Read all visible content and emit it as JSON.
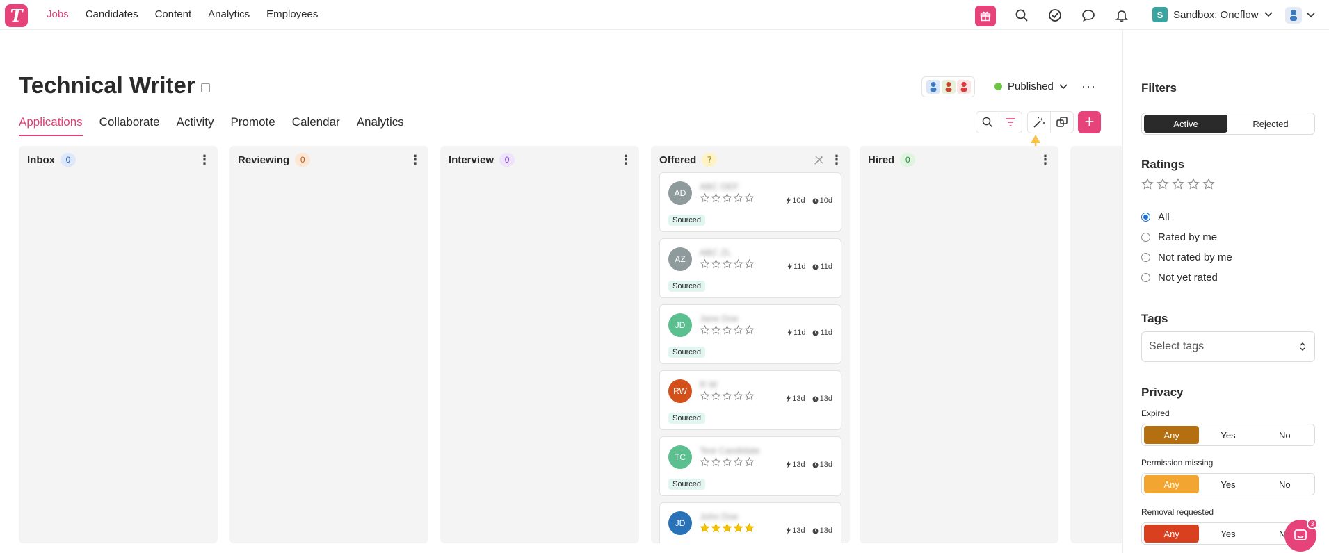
{
  "nav": {
    "logo": "T",
    "links": [
      {
        "label": "Jobs",
        "active": true
      },
      {
        "label": "Candidates",
        "active": false
      },
      {
        "label": "Content",
        "active": false
      },
      {
        "label": "Analytics",
        "active": false
      },
      {
        "label": "Employees",
        "active": false
      }
    ],
    "icons": [
      "gift-icon",
      "search-icon",
      "check-circle-icon",
      "chat-icon",
      "bell-icon"
    ],
    "workspace_badge": "S",
    "workspace_name": "Sandbox: Oneflow"
  },
  "job": {
    "title": "Technical Writer",
    "status": "Published",
    "status_color": "#6cc644"
  },
  "tabs": [
    {
      "label": "Applications",
      "active": true
    },
    {
      "label": "Collaborate",
      "active": false
    },
    {
      "label": "Activity",
      "active": false
    },
    {
      "label": "Promote",
      "active": false
    },
    {
      "label": "Calendar",
      "active": false
    },
    {
      "label": "Analytics",
      "active": false
    }
  ],
  "toolbar": {
    "add_label": "+"
  },
  "stages": [
    {
      "name": "Inbox",
      "count": "0",
      "badge_bg": "#dde8fb",
      "badge_fg": "#2a5fc4"
    },
    {
      "name": "Reviewing",
      "count": "0",
      "badge_bg": "#fde6d3",
      "badge_fg": "#b35a16"
    },
    {
      "name": "Interview",
      "count": "0",
      "badge_bg": "#efe3fb",
      "badge_fg": "#7a3fc4"
    },
    {
      "name": "Offered",
      "count": "7",
      "badge_bg": "#fdf3c4",
      "badge_fg": "#8a6a00"
    },
    {
      "name": "Hired",
      "count": "0",
      "badge_bg": "#dff5e0",
      "badge_fg": "#2a8a3a"
    }
  ],
  "candidates": [
    {
      "initials": "AD",
      "name": "ABC DEF",
      "color": "#8e9a9b",
      "rating": 0,
      "activity": "10d",
      "age": "10d",
      "tag": "Sourced"
    },
    {
      "initials": "AZ",
      "name": "ABC ZL",
      "color": "#8e9a9b",
      "rating": 0,
      "activity": "11d",
      "age": "11d",
      "tag": "Sourced"
    },
    {
      "initials": "JD",
      "name": "Jane Doe",
      "color": "#5cbf8f",
      "rating": 0,
      "activity": "11d",
      "age": "11d",
      "tag": "Sourced"
    },
    {
      "initials": "RW",
      "name": "R W",
      "color": "#d4501a",
      "rating": 0,
      "activity": "13d",
      "age": "13d",
      "tag": "Sourced"
    },
    {
      "initials": "TC",
      "name": "Test Candidate",
      "color": "#5cbf8f",
      "rating": 0,
      "activity": "13d",
      "age": "13d",
      "tag": "Sourced"
    },
    {
      "initials": "JD",
      "name": "John Doe",
      "color": "#2a72b8",
      "rating": 5,
      "activity": "13d",
      "age": "13d",
      "tag": ""
    }
  ],
  "filters": {
    "heading": "Filters",
    "state_options": [
      {
        "label": "Active",
        "active": true
      },
      {
        "label": "Rejected",
        "active": false
      }
    ],
    "ratings_heading": "Ratings",
    "rating_options": [
      {
        "label": "All",
        "checked": true
      },
      {
        "label": "Rated by me",
        "checked": false
      },
      {
        "label": "Not rated by me",
        "checked": false
      },
      {
        "label": "Not yet rated",
        "checked": false
      }
    ],
    "tags_heading": "Tags",
    "tags_placeholder": "Select tags",
    "privacy_heading": "Privacy",
    "privacy_rows": [
      {
        "label": "Expired",
        "options": [
          "Any",
          "Yes",
          "No"
        ],
        "active_color": "#b36f10"
      },
      {
        "label": "Permission missing",
        "options": [
          "Any",
          "Yes",
          "No"
        ],
        "active_color": "#f2a530"
      },
      {
        "label": "Removal requested",
        "options": [
          "Any",
          "Yes",
          "No"
        ],
        "active_color": "#d9401f"
      }
    ]
  },
  "chat": {
    "unread": "3"
  },
  "accent_color": "#e5437a"
}
